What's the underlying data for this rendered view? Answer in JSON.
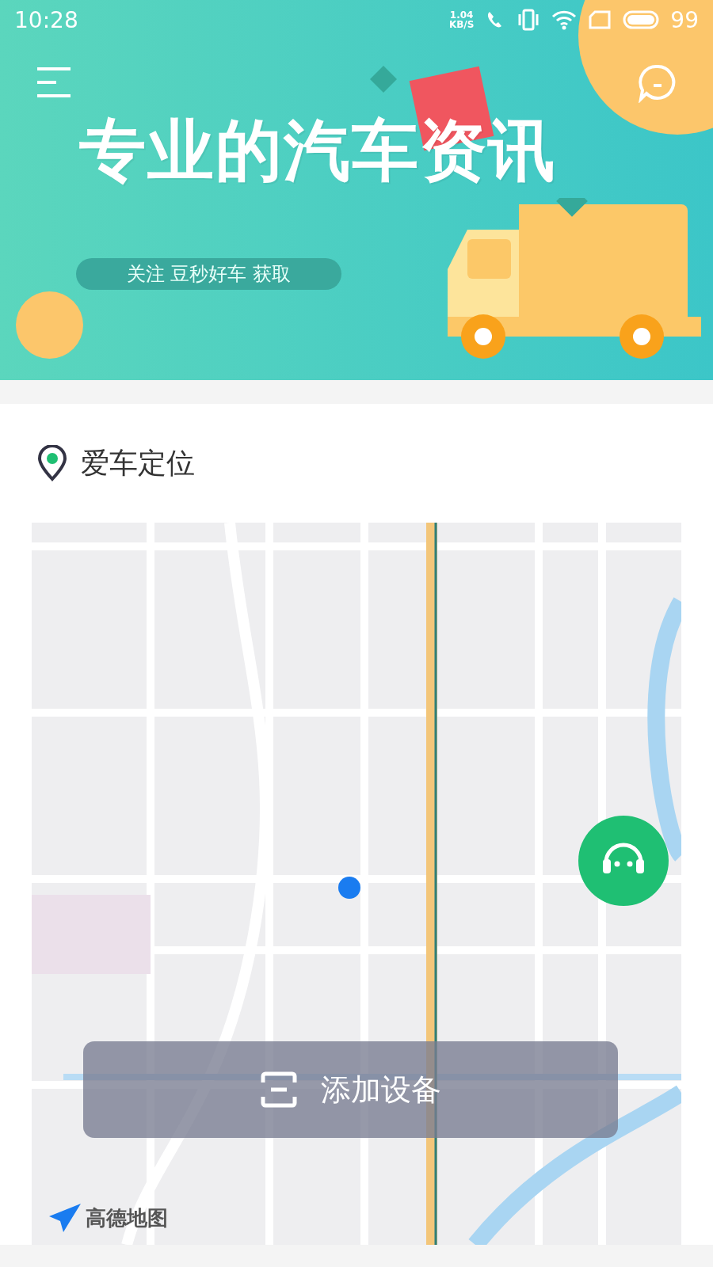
{
  "status_bar": {
    "time": "10:28",
    "net_speed": "1.04",
    "net_unit": "KB/S",
    "battery": "99"
  },
  "banner": {
    "headline": "专业的汽车资讯",
    "tagline": "关注 豆秒好车 获取"
  },
  "location_section": {
    "title": "爱车定位"
  },
  "map": {
    "attribution": "高德地图",
    "add_device_button": "添加设备"
  }
}
